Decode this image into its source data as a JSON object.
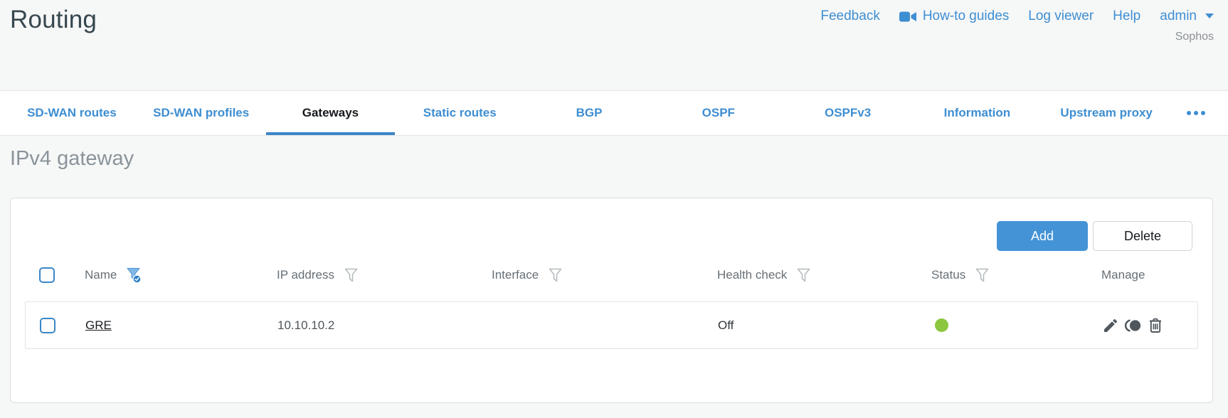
{
  "header": {
    "title": "Routing",
    "nav": {
      "feedback": "Feedback",
      "how_to_guides": "How-to guides",
      "log_viewer": "Log viewer",
      "help": "Help",
      "user": "admin",
      "brand": "Sophos"
    }
  },
  "tabs": {
    "items": [
      {
        "label": "SD-WAN routes",
        "active": false
      },
      {
        "label": "SD-WAN profiles",
        "active": false
      },
      {
        "label": "Gateways",
        "active": true
      },
      {
        "label": "Static routes",
        "active": false
      },
      {
        "label": "BGP",
        "active": false
      },
      {
        "label": "OSPF",
        "active": false
      },
      {
        "label": "OSPFv3",
        "active": false
      },
      {
        "label": "Information",
        "active": false
      },
      {
        "label": "Upstream proxy",
        "active": false
      }
    ],
    "overflow_icon": "ellipsis"
  },
  "section": {
    "heading": "IPv4 gateway"
  },
  "toolbar": {
    "add": "Add",
    "delete": "Delete"
  },
  "table": {
    "columns": [
      {
        "label": "Name",
        "filter": "active"
      },
      {
        "label": "IP address",
        "filter": "default"
      },
      {
        "label": "Interface",
        "filter": "default"
      },
      {
        "label": "Health check",
        "filter": "default"
      },
      {
        "label": "Status",
        "filter": "default"
      },
      {
        "label": "Manage",
        "filter": "none"
      }
    ],
    "rows": [
      {
        "name": "GRE",
        "ip_address": "10.10.10.2",
        "interface": "",
        "health_check": "Off",
        "status": "green"
      }
    ]
  },
  "icons": {
    "how_to_guides": "video-camera",
    "user_menu": "caret-down",
    "column_filter": "funnel",
    "name_filter": "funnel-with-check",
    "edit": "pencil",
    "clone": "overlapping-circles",
    "delete": "trash-can"
  },
  "colors": {
    "accent_blue": "#3e8ed2",
    "add_button_blue": "#4493d6",
    "active_tab_underline": "#3c85c8",
    "status_green": "#8cc63e",
    "title_text": "#37474f",
    "heading_text": "#8b949b"
  }
}
